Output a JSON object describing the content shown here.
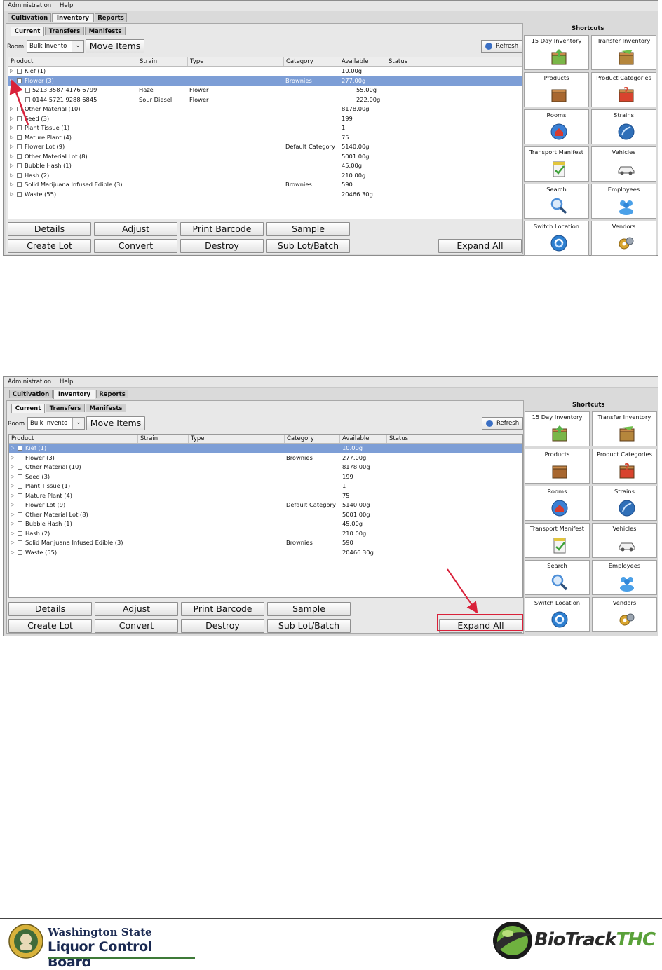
{
  "menu": [
    "Administration",
    "Help"
  ],
  "main_tabs": [
    "Cultivation",
    "Inventory",
    "Reports"
  ],
  "sub_tabs": [
    "Current",
    "Transfers",
    "Manifests"
  ],
  "room_label": "Room",
  "room_select": "Bulk Invento",
  "move_items": "Move Items",
  "refresh": "Refresh",
  "columns": [
    "Product",
    "Strain",
    "Type",
    "Category",
    "Available",
    "Status"
  ],
  "shot1_rows": [
    {
      "product": "Kief (1)",
      "strain": "",
      "type": "",
      "category": "",
      "available": "10.00g",
      "level": 0,
      "expanded": false
    },
    {
      "product": "Flower (3)",
      "strain": "",
      "type": "",
      "category": "Brownies",
      "available": "277.00g",
      "level": 0,
      "expanded": true,
      "selected": true
    },
    {
      "product": "5213 3587 4176 6799",
      "strain": "Haze",
      "type": "Flower",
      "category": "",
      "available": "55.00g",
      "level": 1
    },
    {
      "product": "0144 5721 9288 6845",
      "strain": "Sour Diesel",
      "type": "Flower",
      "category": "",
      "available": "222.00g",
      "level": 1
    },
    {
      "product": "Other Material (10)",
      "strain": "",
      "type": "",
      "category": "",
      "available": "8178.00g",
      "level": 0
    },
    {
      "product": "Seed (3)",
      "strain": "",
      "type": "",
      "category": "",
      "available": "199",
      "level": 0
    },
    {
      "product": "Plant Tissue (1)",
      "strain": "",
      "type": "",
      "category": "",
      "available": "1",
      "level": 0
    },
    {
      "product": "Mature Plant (4)",
      "strain": "",
      "type": "",
      "category": "",
      "available": "75",
      "level": 0
    },
    {
      "product": "Flower Lot (9)",
      "strain": "",
      "type": "",
      "category": "Default Category",
      "available": "5140.00g",
      "level": 0
    },
    {
      "product": "Other Material Lot (8)",
      "strain": "",
      "type": "",
      "category": "",
      "available": "5001.00g",
      "level": 0
    },
    {
      "product": "Bubble Hash (1)",
      "strain": "",
      "type": "",
      "category": "",
      "available": "45.00g",
      "level": 0
    },
    {
      "product": "Hash (2)",
      "strain": "",
      "type": "",
      "category": "",
      "available": "210.00g",
      "level": 0
    },
    {
      "product": "Solid Marijuana Infused Edible (3)",
      "strain": "",
      "type": "",
      "category": "Brownies",
      "available": "590",
      "level": 0
    },
    {
      "product": "Waste (55)",
      "strain": "",
      "type": "",
      "category": "",
      "available": "20466.30g",
      "level": 0
    }
  ],
  "shot2_rows": [
    {
      "product": "Kief (1)",
      "strain": "",
      "type": "",
      "category": "",
      "available": "10.00g",
      "level": 0,
      "selected": true
    },
    {
      "product": "Flower (3)",
      "strain": "",
      "type": "",
      "category": "Brownies",
      "available": "277.00g",
      "level": 0
    },
    {
      "product": "Other Material (10)",
      "strain": "",
      "type": "",
      "category": "",
      "available": "8178.00g",
      "level": 0
    },
    {
      "product": "Seed (3)",
      "strain": "",
      "type": "",
      "category": "",
      "available": "199",
      "level": 0
    },
    {
      "product": "Plant Tissue (1)",
      "strain": "",
      "type": "",
      "category": "",
      "available": "1",
      "level": 0
    },
    {
      "product": "Mature Plant (4)",
      "strain": "",
      "type": "",
      "category": "",
      "available": "75",
      "level": 0
    },
    {
      "product": "Flower Lot (9)",
      "strain": "",
      "type": "",
      "category": "Default Category",
      "available": "5140.00g",
      "level": 0
    },
    {
      "product": "Other Material Lot (8)",
      "strain": "",
      "type": "",
      "category": "",
      "available": "5001.00g",
      "level": 0
    },
    {
      "product": "Bubble Hash (1)",
      "strain": "",
      "type": "",
      "category": "",
      "available": "45.00g",
      "level": 0
    },
    {
      "product": "Hash (2)",
      "strain": "",
      "type": "",
      "category": "",
      "available": "210.00g",
      "level": 0
    },
    {
      "product": "Solid Marijuana Infused Edible (3)",
      "strain": "",
      "type": "",
      "category": "Brownies",
      "available": "590",
      "level": 0
    },
    {
      "product": "Waste (55)",
      "strain": "",
      "type": "",
      "category": "",
      "available": "20466.30g",
      "level": 0
    }
  ],
  "buttons_row1": [
    "Details",
    "Adjust",
    "Print Barcode",
    "Sample"
  ],
  "buttons_row2": [
    "Create Lot",
    "Convert",
    "Destroy",
    "Sub Lot/Batch"
  ],
  "expand_all": "Expand All",
  "shortcuts_title": "Shortcuts",
  "shortcuts": [
    {
      "label": "15 Day Inventory",
      "icon": "inventory-box-icon",
      "color": "#7ab648"
    },
    {
      "label": "Transfer Inventory",
      "icon": "transfer-box-icon",
      "color": "#b5863c"
    },
    {
      "label": "Products",
      "icon": "products-box-icon",
      "color": "#a8672f"
    },
    {
      "label": "Product Categories",
      "icon": "product-categories-icon",
      "color": "#d8432e"
    },
    {
      "label": "Rooms",
      "icon": "rooms-icon",
      "color": "#3a7fd4"
    },
    {
      "label": "Strains",
      "icon": "strains-icon",
      "color": "#2f6fb8"
    },
    {
      "label": "Transport Manifest",
      "icon": "manifest-icon",
      "color": "#e2c53c"
    },
    {
      "label": "Vehicles",
      "icon": "vehicle-icon",
      "color": "#888888"
    },
    {
      "label": "Search",
      "icon": "search-icon",
      "color": "#4d8fd8"
    },
    {
      "label": "Employees",
      "icon": "employees-icon",
      "color": "#4aa0e8"
    },
    {
      "label": "Switch Location",
      "icon": "switch-location-icon",
      "color": "#2d7fd0"
    },
    {
      "label": "Vendors",
      "icon": "vendors-icon",
      "color": "#d9a52e"
    }
  ],
  "annotation_color": "#d9213a",
  "footer": {
    "wslcb_line1": "Washington State",
    "wslcb_line2": "Liquor Control Board",
    "biotrack_bio": "BioTrack",
    "biotrack_thc": "THC"
  }
}
